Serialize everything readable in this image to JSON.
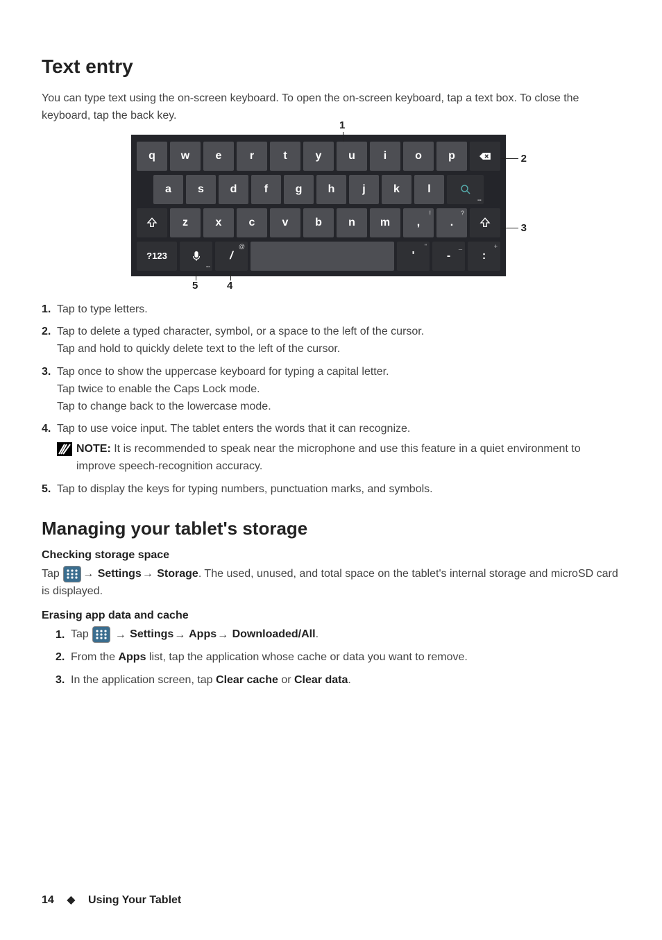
{
  "section1": {
    "title": "Text entry",
    "intro": "You can type text using the on-screen keyboard. To open the on-screen keyboard, tap a text box. To close the keyboard, tap the back key."
  },
  "keyboard": {
    "row1": [
      "q",
      "w",
      "e",
      "r",
      "t",
      "y",
      "u",
      "i",
      "o",
      "p"
    ],
    "row2": [
      "a",
      "s",
      "d",
      "f",
      "g",
      "h",
      "j",
      "k",
      "l"
    ],
    "row3": [
      "z",
      "x",
      "c",
      "v",
      "b",
      "n",
      "m",
      ",",
      "."
    ],
    "row3_hints": {
      "comma": "!",
      "period": "?"
    },
    "row4": {
      "numkey": "?123",
      "slash": "/",
      "slash_hint": "@",
      "apos": "'",
      "apos_hint": "\"",
      "dash": "-",
      "dash_hint": "_",
      "colon": ":",
      "colon_hint": "+"
    },
    "callouts": {
      "1": "1",
      "2": "2",
      "3": "3",
      "4": "4",
      "5": "5"
    }
  },
  "list1": {
    "i1": {
      "num": "1.",
      "text": "Tap to type letters."
    },
    "i2": {
      "num": "2.",
      "line1": "Tap to delete a typed character, symbol, or a space to the left of the cursor.",
      "line2": "Tap and hold to quickly delete text to the left of the cursor."
    },
    "i3": {
      "num": "3.",
      "line1": "Tap once to show the uppercase keyboard for typing a capital letter.",
      "line2": "Tap twice to enable the Caps Lock mode.",
      "line3": "Tap to change back to the lowercase mode."
    },
    "i4": {
      "num": "4.",
      "text": "Tap to use voice input. The tablet enters the words that it can recognize.",
      "note_label": "NOTE:",
      "note_text": " It is recommended to speak near the microphone and use this feature in a quiet environment to improve speech-recognition accuracy."
    },
    "i5": {
      "num": "5.",
      "text": "Tap to display the keys for typing numbers, punctuation marks, and symbols."
    }
  },
  "section2": {
    "title": "Managing your tablet's storage",
    "h3a": "Checking storage space",
    "p_check_pre": "Tap ",
    "p_check_mid1": " Settings",
    "p_check_mid2": " Storage",
    "p_check_post": ". The used, unused, and total space on the tablet's internal storage and microSD card is displayed.",
    "h3b": "Erasing app data and cache",
    "steps": {
      "s1": {
        "num": "1.",
        "pre": "Tap ",
        "seg1": " Settings",
        "seg2": " Apps",
        "seg3": " Downloaded/All",
        "post": "."
      },
      "s2": {
        "num": "2.",
        "pre": "From the ",
        "b": "Apps",
        "post": " list, tap the application whose cache or data you want to remove."
      },
      "s3": {
        "num": "3.",
        "pre": "In the application screen, tap ",
        "b1": "Clear cache",
        "mid": " or ",
        "b2": "Clear data",
        "post": "."
      }
    }
  },
  "footer": {
    "page": "14",
    "diamond": "◆",
    "section": "Using Your Tablet"
  },
  "glyphs": {
    "arrow": "→"
  }
}
